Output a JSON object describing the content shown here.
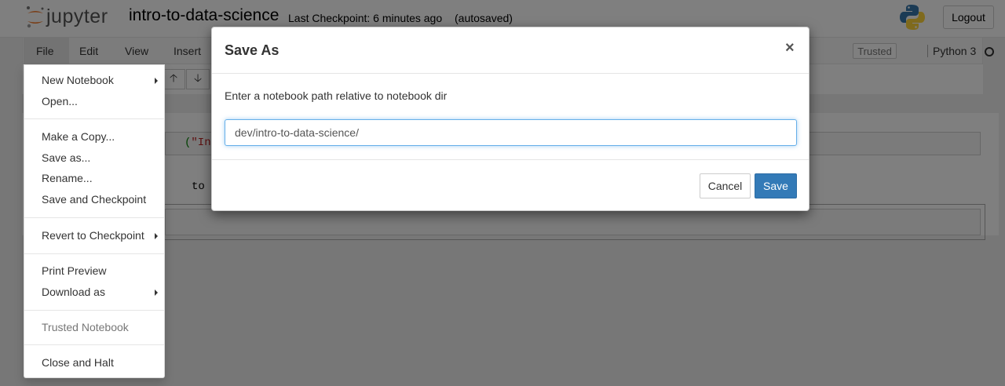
{
  "header": {
    "logo_text": "jupyter",
    "notebook_title": "intro-to-data-science",
    "checkpoint_text": "Last Checkpoint: 6 minutes ago",
    "autosave_status": "(autosaved)",
    "logout_label": "Logout",
    "kernel_logo": "python-logo-icon"
  },
  "menubar": {
    "items": [
      "File",
      "Edit",
      "View",
      "Insert"
    ],
    "trusted_label": "Trusted",
    "kernel_name": "Python 3"
  },
  "toolbar": {
    "buttons": [
      "arrow-up-icon",
      "arrow-down-icon"
    ]
  },
  "notebook": {
    "cell1_code_prefix": "(",
    "cell1_code_string": "\"Intro",
    "cell1_output": "to Dat"
  },
  "file_menu": {
    "items": [
      {
        "label": "New Notebook",
        "submenu": true
      },
      {
        "label": "Open...",
        "submenu": false
      },
      {
        "label": "Make a Copy...",
        "submenu": false
      },
      {
        "label": "Save as...",
        "submenu": false
      },
      {
        "label": "Rename...",
        "submenu": false
      },
      {
        "label": "Save and Checkpoint",
        "submenu": false
      },
      {
        "label": "Revert to Checkpoint",
        "submenu": true
      },
      {
        "label": "Print Preview",
        "submenu": false
      },
      {
        "label": "Download as",
        "submenu": true
      },
      {
        "label": "Trusted Notebook",
        "submenu": false,
        "disabled": true
      },
      {
        "label": "Close and Halt",
        "submenu": false
      }
    ]
  },
  "modal": {
    "title": "Save As",
    "close_glyph": "×",
    "prompt": "Enter a notebook path relative to notebook dir",
    "input_value": "dev/intro-to-data-science/",
    "cancel_label": "Cancel",
    "save_label": "Save",
    "accent_color": "#337ab7"
  }
}
